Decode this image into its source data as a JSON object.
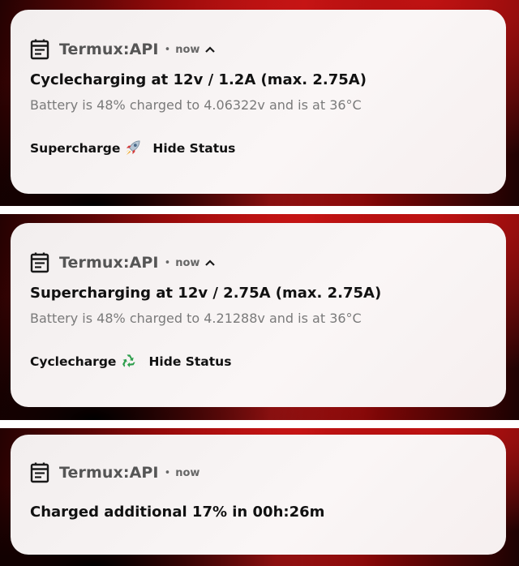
{
  "notifications": [
    {
      "app_name": "Termux:API",
      "separator": "•",
      "time": "now",
      "expanded": true,
      "title": "Cyclecharging at 12v / 1.2A (max. 2.75A)",
      "body": "Battery is 48% charged to 4.06322v and is at 36°C",
      "actions": [
        {
          "label": "Supercharge",
          "icon": "rocket-icon"
        },
        {
          "label": "Hide Status"
        }
      ]
    },
    {
      "app_name": "Termux:API",
      "separator": "•",
      "time": "now",
      "expanded": true,
      "title": "Supercharging at 12v / 2.75A (max. 2.75A)",
      "body": "Battery is 48% charged to 4.21288v and is at 36°C",
      "actions": [
        {
          "label": "Cyclecharge",
          "icon": "recycle-icon"
        },
        {
          "label": "Hide Status"
        }
      ]
    },
    {
      "app_name": "Termux:API",
      "separator": "•",
      "time": "now",
      "expanded": false,
      "title": "Charged additional 17% in 00h:26m"
    }
  ],
  "colors": {
    "card_background": "#f7f3f3",
    "wallpaper_red": "#c01212",
    "wallpaper_dark": "#1a0202",
    "title_text": "#111111",
    "body_text": "#7a7a7a",
    "app_name_text": "#555555",
    "rocket_body": "#b6c6d4",
    "rocket_flame": "#f2a21b",
    "recycle_green": "#2e9e4c"
  }
}
